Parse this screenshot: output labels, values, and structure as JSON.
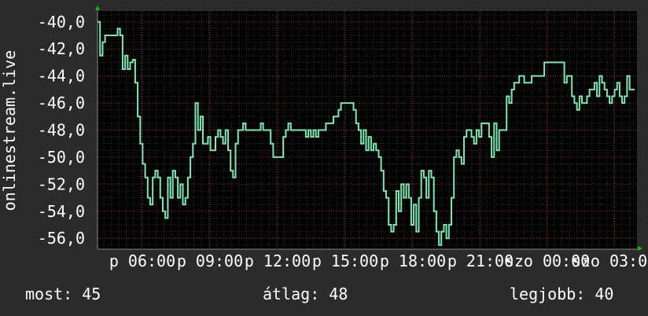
{
  "chart_data": {
    "type": "line",
    "ylabel": "onlinestream.live",
    "ylim": [
      -56.8,
      -39.2
    ],
    "y_ticks": [
      -40,
      -42,
      -44,
      -46,
      -48,
      -50,
      -52,
      -54,
      -56
    ],
    "y_tick_labels": [
      "-40,0",
      "-42,0",
      "-44,0",
      "-46,0",
      "-48,0",
      "-50,0",
      "-52,0",
      "-54,0",
      "-56,0"
    ],
    "x_tick_labels": [
      "p 06:00",
      "p 09:00",
      "p 12:00",
      "p 15:00",
      "p 18:00",
      "p 21:00",
      "szo 00:00",
      "szo 03:00"
    ],
    "grid": true,
    "colors": {
      "line": "#7fe8b0",
      "grid": "#a0303a",
      "axis": "#888888",
      "arrow": "#00cc00",
      "background": "#000000"
    },
    "series": [
      {
        "values": [
          -40.0,
          -42.5,
          -41.5,
          -41.0,
          -41.0,
          -41.0,
          -41.0,
          -41.0,
          -40.5,
          -41.0,
          -43.5,
          -42.5,
          -43.5,
          -43.0,
          -42.8,
          -44.5,
          -47.0,
          -49.0,
          -50.5,
          -51.5,
          -53.0,
          -53.5,
          -51.5,
          -51.0,
          -51.5,
          -53.0,
          -54.0,
          -54.5,
          -51.5,
          -53.0,
          -51.0,
          -51.5,
          -53.0,
          -52.0,
          -53.5,
          -53.0,
          -51.5,
          -50.0,
          -49.0,
          -46.0,
          -48.0,
          -47.0,
          -49.0,
          -49.0,
          -48.5,
          -49.5,
          -49.5,
          -48.5,
          -48.0,
          -48.5,
          -49.0,
          -48.0,
          -49.5,
          -51.0,
          -51.5,
          -49.0,
          -48.0,
          -48.0,
          -47.5,
          -48.0,
          -48.0,
          -48.0,
          -48.0,
          -48.0,
          -48.0,
          -47.5,
          -48.0,
          -48.0,
          -48.0,
          -49.0,
          -50.0,
          -50.0,
          -50.0,
          -50.0,
          -48.5,
          -48.0,
          -47.5,
          -48.0,
          -48.0,
          -48.0,
          -48.0,
          -48.0,
          -48.0,
          -48.5,
          -48.0,
          -48.5,
          -48.0,
          -48.5,
          -48.0,
          -48.0,
          -48.0,
          -47.5,
          -47.5,
          -47.5,
          -47.0,
          -47.0,
          -46.5,
          -46.0,
          -46.0,
          -46.0,
          -46.0,
          -46.0,
          -46.5,
          -47.5,
          -48.0,
          -49.0,
          -48.0,
          -49.5,
          -48.5,
          -49.5,
          -49.0,
          -49.5,
          -50.0,
          -51.0,
          -52.5,
          -53.0,
          -55.0,
          -55.5,
          -55.0,
          -52.5,
          -54.0,
          -52.0,
          -53.0,
          -52.0,
          -53.0,
          -55.0,
          -53.5,
          -55.5,
          -53.0,
          -51.0,
          -51.5,
          -53.0,
          -51.0,
          -51.5,
          -54.0,
          -55.5,
          -56.5,
          -55.5,
          -55.0,
          -56.0,
          -55.0,
          -53.0,
          -50.0,
          -49.5,
          -50.0,
          -50.5,
          -48.5,
          -48.0,
          -48.0,
          -48.5,
          -49.0,
          -48.0,
          -48.5,
          -47.5,
          -47.5,
          -47.5,
          -48.5,
          -50.0,
          -47.5,
          -49.5,
          -48.0,
          -48.0,
          -48.0,
          -45.5,
          -46.0,
          -45.0,
          -44.5,
          -44.5,
          -44.0,
          -44.0,
          -44.5,
          -44.5,
          -44.5,
          -44.0,
          -44.0,
          -44.0,
          -44.0,
          -44.0,
          -43.0,
          -43.0,
          -43.0,
          -43.0,
          -43.0,
          -43.0,
          -43.0,
          -43.0,
          -44.5,
          -44.0,
          -44.0,
          -45.5,
          -46.0,
          -46.5,
          -45.5,
          -46.0,
          -46.0,
          -45.5,
          -45.0,
          -45.0,
          -44.5,
          -45.5,
          -44.0,
          -44.5,
          -45.0,
          -45.5,
          -46.0,
          -45.5,
          -45.0,
          -44.5,
          -45.5,
          -46.0,
          -45.5,
          -44.0,
          -45.0,
          -45.0,
          -45.0
        ]
      }
    ]
  },
  "stats": {
    "current": "most: 45",
    "average": "átlag: 48",
    "best": "legjobb: 40"
  }
}
